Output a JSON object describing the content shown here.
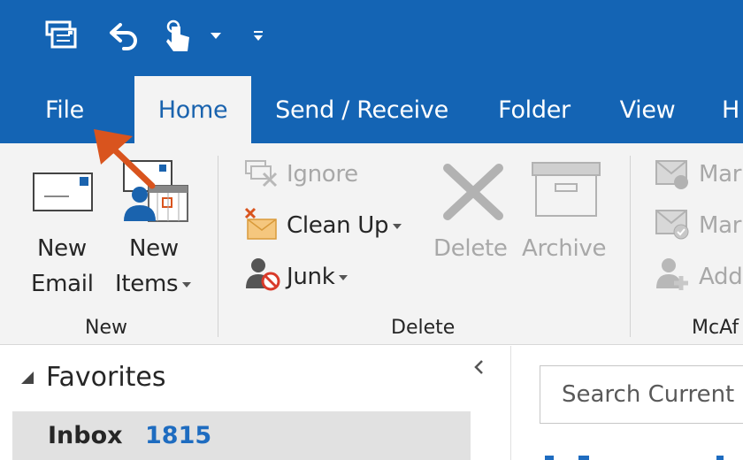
{
  "quick_access": {
    "icons": [
      "send-receive-icon",
      "undo-icon",
      "touch-mode-icon",
      "customize-dropdown-icon",
      "more-icon"
    ]
  },
  "tabs": [
    {
      "label": "File",
      "active": false
    },
    {
      "label": "Home",
      "active": true
    },
    {
      "label": "Send / Receive",
      "active": false
    },
    {
      "label": "Folder",
      "active": false
    },
    {
      "label": "View",
      "active": false
    },
    {
      "label": "H",
      "active": false
    }
  ],
  "ribbon": {
    "new_group": {
      "new_email_line1": "New",
      "new_email_line2": "Email",
      "new_items_line1": "New",
      "new_items_line2": "Items",
      "label": "New"
    },
    "delete_group": {
      "ignore": "Ignore",
      "clean_up": "Clean Up",
      "junk": "Junk",
      "delete": "Delete",
      "archive": "Archive",
      "label": "Delete"
    },
    "mcafee_group": {
      "item1": "Mar",
      "item2": "Mar",
      "item3": "Add",
      "label": "McAf"
    }
  },
  "folder_pane": {
    "favorites": "Favorites",
    "inbox_label": "Inbox",
    "inbox_count": "1815"
  },
  "search": {
    "placeholder": "Search Current M"
  },
  "colors": {
    "title_bar": "#1464b4",
    "ribbon_bg": "#f3f3f3",
    "accent_arrow": "#d9541e",
    "count_blue": "#1e6cc0"
  }
}
